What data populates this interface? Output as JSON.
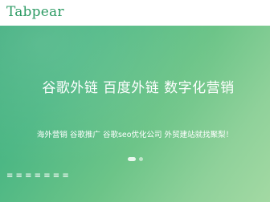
{
  "header": {
    "logo_text": "Tabpear"
  },
  "hero": {
    "title": "谷歌外链 百度外链 数字化营销",
    "subtitle": "海外营销 谷歌推广 谷歌seo优化公司 外贸建站就找聚梨！",
    "slider_dots": 2,
    "active_dot": 0
  },
  "footer": {
    "text": "≡ ≡ ≡ ≡ ≡ ≡ ≡"
  },
  "colors": {
    "brand": "#2d9b64",
    "hero_start": "#3fae7e",
    "hero_end": "#a3d9a3"
  }
}
